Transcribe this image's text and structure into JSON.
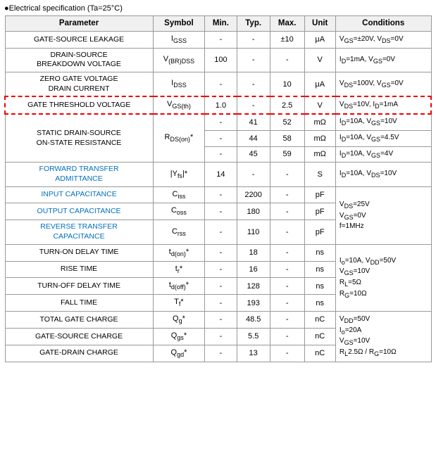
{
  "header": {
    "title": "●Electrical specification (Ta=25°C)"
  },
  "table": {
    "columns": [
      "Parameter",
      "Symbol",
      "Min.",
      "Typ.",
      "Max.",
      "Unit",
      "Conditions"
    ],
    "rows": [
      {
        "parameter": "GATE-SOURCE LEAKAGE",
        "symbol": "Igss",
        "min": "-",
        "typ": "-",
        "max": "±10",
        "unit": "μA",
        "conditions": "VGS=±20V, VDS=0V",
        "blue": false,
        "highlight": false,
        "rowspan": false
      },
      {
        "parameter": "DRAIN-SOURCE BREAKDOWN VOLTAGE",
        "symbol": "V(BR)DSS",
        "min": "100",
        "typ": "-",
        "max": "-",
        "unit": "V",
        "conditions": "ID=1mA, VGS=0V",
        "blue": false,
        "highlight": false
      },
      {
        "parameter": "ZERO GATE VOLTAGE DRAIN CURRENT",
        "symbol": "IDSS",
        "min": "-",
        "typ": "-",
        "max": "10",
        "unit": "μA",
        "conditions": "VDS=100V, VGS=0V",
        "blue": false,
        "highlight": false
      },
      {
        "parameter": "GATE THRESHOLD VOLTAGE",
        "symbol": "VGS(th)",
        "min": "1.0",
        "typ": "-",
        "max": "2.5",
        "unit": "V",
        "conditions": "VDS=10V, ID=1mA",
        "blue": false,
        "highlight": true
      },
      {
        "parameter": "STATIC DRAIN-SOURCE ON-STATE RESISTANCE",
        "symbol": "RDS(on)*",
        "rows3": [
          {
            "min": "-",
            "typ": "41",
            "max": "52",
            "unit": "mΩ",
            "conditions": "ID=10A, VGS=10V"
          },
          {
            "min": "-",
            "typ": "44",
            "max": "58",
            "unit": "mΩ",
            "conditions": "ID=10A, VGS=4.5V"
          },
          {
            "min": "-",
            "typ": "45",
            "max": "59",
            "unit": "mΩ",
            "conditions": "ID=10A, VGS=4V"
          }
        ],
        "blue": false,
        "highlight": false,
        "multirow": true
      },
      {
        "parameter": "FORWARD TRANSFER ADMITTANCE",
        "symbol": "|Yfs|*",
        "min": "14",
        "typ": "-",
        "max": "-",
        "unit": "S",
        "conditions": "ID=10A, VDS=10V",
        "blue": true,
        "highlight": false
      },
      {
        "parameter": "INPUT CAPACITANCE",
        "symbol": "Ciss",
        "min": "-",
        "typ": "2200",
        "max": "-",
        "unit": "pF",
        "conditions": "",
        "blue": true,
        "highlight": false,
        "condrowspan": true
      },
      {
        "parameter": "OUTPUT CAPACITANCE",
        "symbol": "Coss",
        "min": "-",
        "typ": "180",
        "max": "-",
        "unit": "pF",
        "conditions": "",
        "blue": true,
        "highlight": false,
        "condrowspan": true
      },
      {
        "parameter": "REVERSE TRANSFER CAPACITANCE",
        "symbol": "Crss",
        "min": "-",
        "typ": "110",
        "max": "-",
        "unit": "pF",
        "conditions": "",
        "blue": true,
        "highlight": false,
        "condrowspan": true
      },
      {
        "parameter": "TURN-ON DELAY TIME",
        "symbol": "td(on)*",
        "min": "-",
        "typ": "18",
        "max": "-",
        "unit": "ns",
        "conditions": "",
        "blue": false,
        "highlight": false,
        "condrowspan4": true
      },
      {
        "parameter": "RISE TIME",
        "symbol": "tr*",
        "min": "-",
        "typ": "16",
        "max": "-",
        "unit": "ns",
        "conditions": "",
        "blue": false,
        "highlight": false
      },
      {
        "parameter": "TURN-OFF DELAY TIME",
        "symbol": "td(off)*",
        "min": "-",
        "typ": "128",
        "max": "-",
        "unit": "ns",
        "conditions": "",
        "blue": false,
        "highlight": false
      },
      {
        "parameter": "FALL TIME",
        "symbol": "Tf*",
        "min": "-",
        "typ": "193",
        "max": "-",
        "unit": "ns",
        "conditions": "",
        "blue": false,
        "highlight": false
      },
      {
        "parameter": "TOTAL GATE CHARGE",
        "symbol": "Qg*",
        "min": "-",
        "typ": "48.5",
        "max": "-",
        "unit": "nC",
        "conditions": "",
        "blue": false,
        "highlight": false,
        "condrowspan3": true
      },
      {
        "parameter": "GATE-SOURCE CHARGE",
        "symbol": "Qgs*",
        "min": "-",
        "typ": "5.5",
        "max": "-",
        "unit": "nC",
        "conditions": "",
        "blue": false,
        "highlight": false
      },
      {
        "parameter": "GATE-DRAIN CHARGE",
        "symbol": "Qgd*",
        "min": "-",
        "typ": "13",
        "max": "-",
        "unit": "nC",
        "conditions": "",
        "blue": false,
        "highlight": false
      }
    ],
    "cap_conditions": "VDS=25V\nVGS=0V\nf=1MHz",
    "switch_conditions": "Io=10A, VDD=50V\nVGS=10V\nRL=5Ω\nRG=10Ω",
    "charge_conditions": "VDD=50V\nIo=20A\nVGS=10V\nRL2.5Ω / RG=10Ω"
  }
}
